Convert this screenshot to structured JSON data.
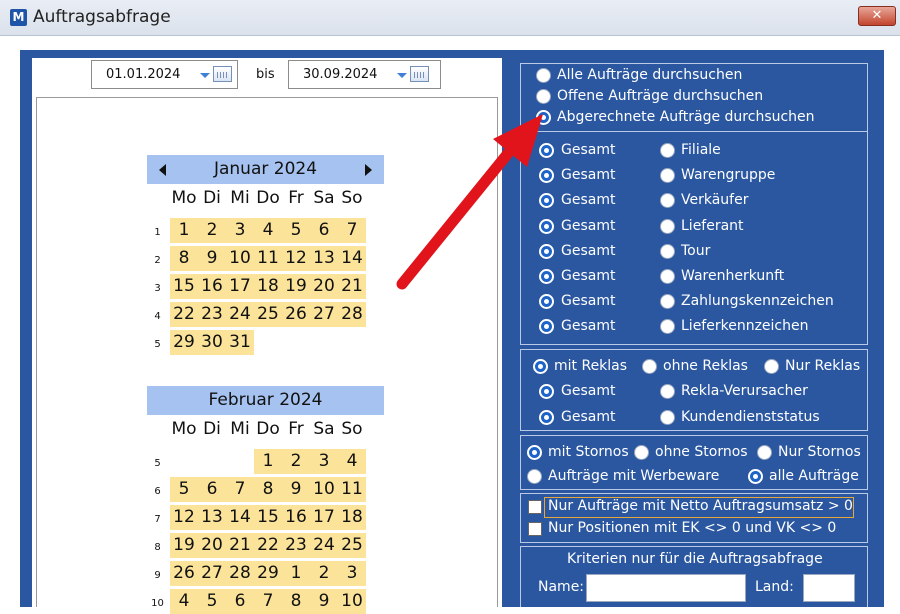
{
  "window": {
    "icon_letter": "M",
    "title": "Auftragsabfrage",
    "close_icon": "close-x-icon",
    "close_glyph": "✕"
  },
  "date_range": {
    "from": "01.01.2024",
    "separator": "bis",
    "to": "30.09.2024"
  },
  "calendar": {
    "weekday_headers": [
      "Mo",
      "Di",
      "Mi",
      "Do",
      "Fr",
      "Sa",
      "So"
    ],
    "months": [
      {
        "name": "Januar 2024",
        "show_nav": true,
        "weeks": [
          {
            "week": "1",
            "days": [
              "1",
              "2",
              "3",
              "4",
              "5",
              "6",
              "7"
            ]
          },
          {
            "week": "2",
            "days": [
              "8",
              "9",
              "10",
              "11",
              "12",
              "13",
              "14"
            ]
          },
          {
            "week": "3",
            "days": [
              "15",
              "16",
              "17",
              "18",
              "19",
              "20",
              "21"
            ]
          },
          {
            "week": "4",
            "days": [
              "22",
              "23",
              "24",
              "25",
              "26",
              "27",
              "28"
            ]
          },
          {
            "week": "5",
            "days": [
              "29",
              "30",
              "31",
              "",
              "",
              "",
              ""
            ]
          }
        ]
      },
      {
        "name": "Februar 2024",
        "show_nav": false,
        "weeks": [
          {
            "week": "5",
            "days": [
              "",
              "",
              "",
              "1",
              "2",
              "3",
              "4"
            ]
          },
          {
            "week": "6",
            "days": [
              "5",
              "6",
              "7",
              "8",
              "9",
              "10",
              "11"
            ]
          },
          {
            "week": "7",
            "days": [
              "12",
              "13",
              "14",
              "15",
              "16",
              "17",
              "18"
            ]
          },
          {
            "week": "8",
            "days": [
              "19",
              "20",
              "21",
              "22",
              "23",
              "24",
              "25"
            ]
          },
          {
            "week": "9",
            "days": [
              "26",
              "27",
              "28",
              "29",
              "1",
              "2",
              "3"
            ]
          },
          {
            "week": "10",
            "days": [
              "4",
              "5",
              "6",
              "7",
              "8",
              "9",
              "10"
            ]
          }
        ]
      }
    ]
  },
  "search_scope": {
    "options": [
      {
        "label": "Alle Aufträge durchsuchen",
        "checked": false
      },
      {
        "label": "Offene Aufträge durchsuchen",
        "checked": false
      },
      {
        "label": "Abgerechnete Aufträge durchsuchen",
        "checked": true
      }
    ]
  },
  "filters": {
    "rows": [
      {
        "left": "Gesamt",
        "right": "Filiale"
      },
      {
        "left": "Gesamt",
        "right": "Warengruppe"
      },
      {
        "left": "Gesamt",
        "right": "Verkäufer"
      },
      {
        "left": "Gesamt",
        "right": "Lieferant"
      },
      {
        "left": "Gesamt",
        "right": "Tour"
      },
      {
        "left": "Gesamt",
        "right": "Warenherkunft"
      },
      {
        "left": "Gesamt",
        "right": "Zahlungskennzeichen"
      },
      {
        "left": "Gesamt",
        "right": "Lieferkennzeichen"
      }
    ]
  },
  "reklas": {
    "top": [
      "mit Reklas",
      "ohne Reklas",
      "Nur Reklas"
    ],
    "top_checked": 0,
    "rows": [
      {
        "left": "Gesamt",
        "right": "Rekla-Verursacher"
      },
      {
        "left": "Gesamt",
        "right": "Kundendienststatus"
      }
    ]
  },
  "stornos": {
    "top": [
      "mit Stornos",
      "ohne Stornos",
      "Nur Stornos"
    ],
    "top_checked": 0,
    "bottom": [
      "Aufträge mit Werbeware",
      "alle Aufträge"
    ],
    "bottom_checked": 1
  },
  "checkboxes": [
    {
      "label": "Nur Aufträge mit Netto Auftragsumsatz > 0",
      "checked": false
    },
    {
      "label": "Nur Positionen mit EK <> 0 und VK <> 0",
      "checked": false
    }
  ],
  "criteria": {
    "heading": "Kriterien nur für die Auftragsabfrage",
    "name_label": "Name:",
    "land_label": "Land:"
  },
  "colors": {
    "panel_blue": "#2a57a0",
    "month_header": "#a6c2f0",
    "day_highlight": "#fbe39a",
    "annotation_arrow": "#e0141a"
  }
}
